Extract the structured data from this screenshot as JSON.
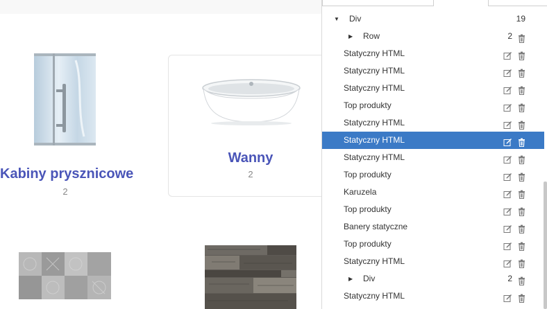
{
  "categories": [
    {
      "title": "Kabiny prysznicowe",
      "count": "2"
    },
    {
      "title": "Wanny",
      "count": "2"
    }
  ],
  "tree": {
    "root": {
      "label": "Div",
      "count": "19"
    },
    "rows": [
      {
        "label": "Row",
        "count": "2",
        "type": "group"
      },
      {
        "label": "Statyczny HTML",
        "type": "item"
      },
      {
        "label": "Statyczny HTML",
        "type": "item"
      },
      {
        "label": "Statyczny HTML",
        "type": "item"
      },
      {
        "label": "Top produkty",
        "type": "item"
      },
      {
        "label": "Statyczny HTML",
        "type": "item"
      },
      {
        "label": "Statyczny HTML",
        "type": "item",
        "selected": true
      },
      {
        "label": "Statyczny HTML",
        "type": "item"
      },
      {
        "label": "Top produkty",
        "type": "item"
      },
      {
        "label": "Karuzela",
        "type": "item"
      },
      {
        "label": "Top produkty",
        "type": "item"
      },
      {
        "label": "Banery statyczne",
        "type": "item"
      },
      {
        "label": "Top produkty",
        "type": "item"
      },
      {
        "label": "Statyczny HTML",
        "type": "item"
      },
      {
        "label": "Div",
        "count": "2",
        "type": "group"
      },
      {
        "label": "Statyczny HTML",
        "type": "item"
      }
    ]
  },
  "icons": {
    "edit": "pencil-square-icon",
    "delete": "trash-icon",
    "expand": "caret-right-icon",
    "collapse": "caret-down-icon"
  },
  "colors": {
    "accent": "#4a55b8",
    "selected": "#3b7ac6"
  }
}
